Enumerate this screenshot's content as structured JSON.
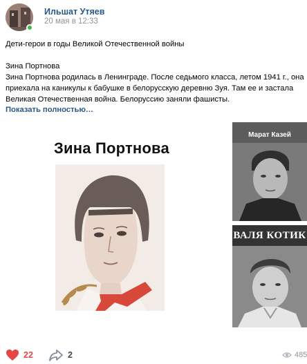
{
  "post": {
    "author": "Ильшат Утяев",
    "date": "20 мая в 12:33",
    "text": {
      "title": "Дети-герои в годы Великой Отечественной войны",
      "lines": [
        "Зина Портнова",
        "Зина Портнова родилась в Ленинграде. После седьмого класса, летом 1941 г., она",
        "приехала на каникулы к бабушке в белорусскую деревню Зуя. Там ее и застала",
        "Великая Отечественная война. Белоруссию заняли фашисты."
      ],
      "show_more": "Показать полностью…"
    },
    "media": {
      "main_heading": "Зина Портнова",
      "side_1_label": "Марат Казей",
      "side_2_label": "ВАЛЯ КОТИК"
    },
    "footer": {
      "likes": "22",
      "shares": "2",
      "views": "485"
    },
    "colors": {
      "link": "#2a5885",
      "like": "#e64646",
      "online": "#4bb34b",
      "meta": "#939393"
    },
    "icons": [
      "heart-icon",
      "share-icon",
      "eye-icon"
    ]
  }
}
